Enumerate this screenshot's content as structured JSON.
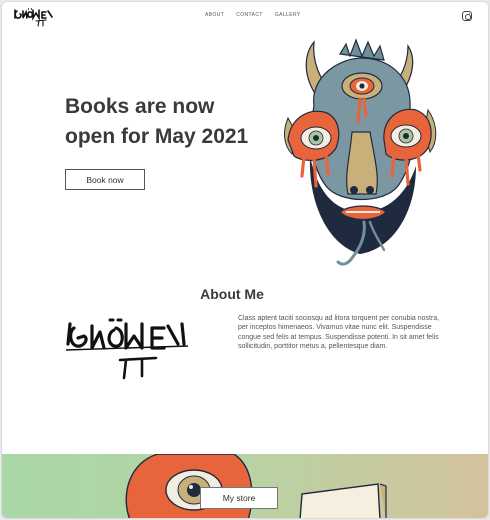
{
  "header": {
    "nav": [
      "ABOUT",
      "CONTACT",
      "GALLERY"
    ]
  },
  "hero": {
    "title_line1": "Books are now",
    "title_line2": "open for May 2021",
    "cta_label": "Book now"
  },
  "about": {
    "title": "About Me",
    "body": "Class aptent taciti sociosqu ad litora torquent per conubia nostra, per inceptos himenaeos. Vivamus vitae nunc elit. Suspendisse congue sed felis at tempus. Suspendisse potenti. In sit amet felis sollicitudin, porttitor metus a, pellentesque diam."
  },
  "store": {
    "cta_label": "My store"
  },
  "colors": {
    "mask_orange": "#e8643a",
    "mask_slate": "#6f8f9a",
    "mask_navy": "#1f2a3f",
    "mask_horn": "#c9b07a",
    "banner_green": "#a9d7a7",
    "banner_tan": "#d4c29d"
  },
  "icons": [
    "instagram-icon"
  ]
}
